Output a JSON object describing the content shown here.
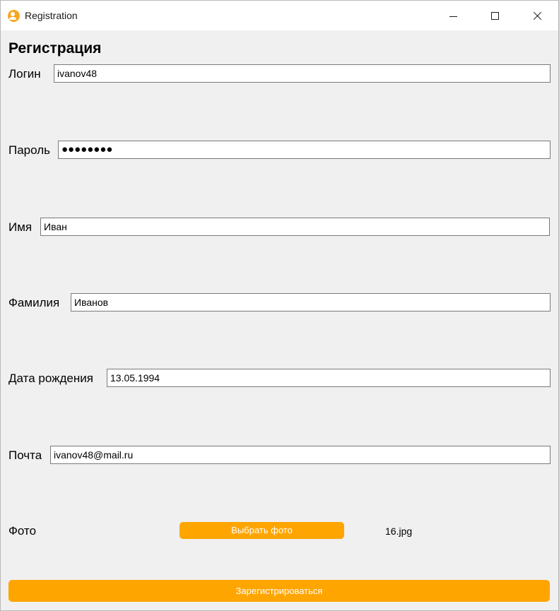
{
  "window": {
    "title": "Registration",
    "controls": {
      "minimize": "minimize",
      "maximize": "maximize",
      "close": "close"
    }
  },
  "form": {
    "heading": "Регистрация",
    "login": {
      "label": "Логин",
      "value": "ivanov48"
    },
    "password": {
      "label": "Пароль",
      "value": "●●●●●●●●"
    },
    "first_name": {
      "label": "Имя",
      "value": "Иван"
    },
    "last_name": {
      "label": "Фамилия",
      "value": "Иванов"
    },
    "birth_date": {
      "label": "Дата рождения",
      "value": "13.05.1994"
    },
    "email": {
      "label": "Почта",
      "value": "ivanov48@mail.ru"
    },
    "photo": {
      "label": "Фото",
      "button_label": "Выбрать фото",
      "file_name": "16.jpg"
    },
    "submit_label": "Зарегистрироваться"
  },
  "colors": {
    "accent": "#ffa500",
    "background": "#f0f0f0",
    "titlebar": "#ffffff"
  },
  "icons": {
    "app": "user-icon"
  }
}
